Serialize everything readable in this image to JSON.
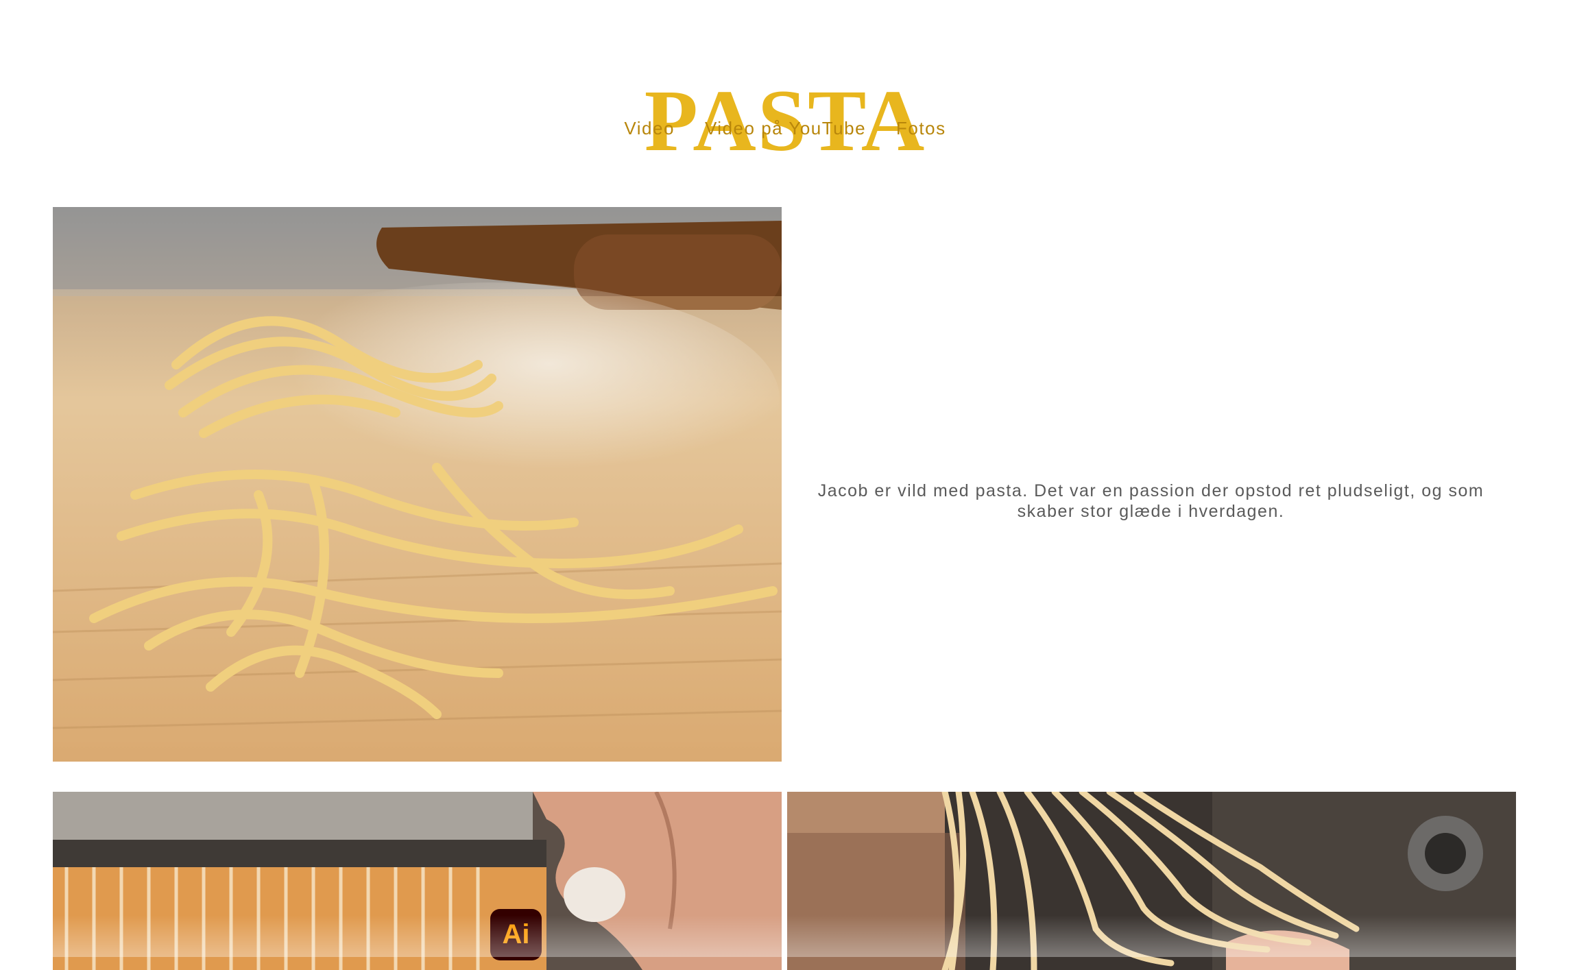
{
  "site": {
    "title": "PASTA"
  },
  "nav": {
    "items": [
      {
        "label": "Video"
      },
      {
        "label": "Video på YouTube"
      },
      {
        "label": "Fotos"
      }
    ]
  },
  "intro": {
    "text": "Jacob er vild med pasta. Det var en passion der opstod ret pludseligt, og som skaber stor glæde i hverdagen."
  },
  "badge": {
    "label": "Ai"
  },
  "colors": {
    "title": "#e8b61e",
    "nav": "#b8860b",
    "body_text": "#5a5a5a",
    "badge_bg": "#330000",
    "badge_fg": "#ff9a00"
  }
}
